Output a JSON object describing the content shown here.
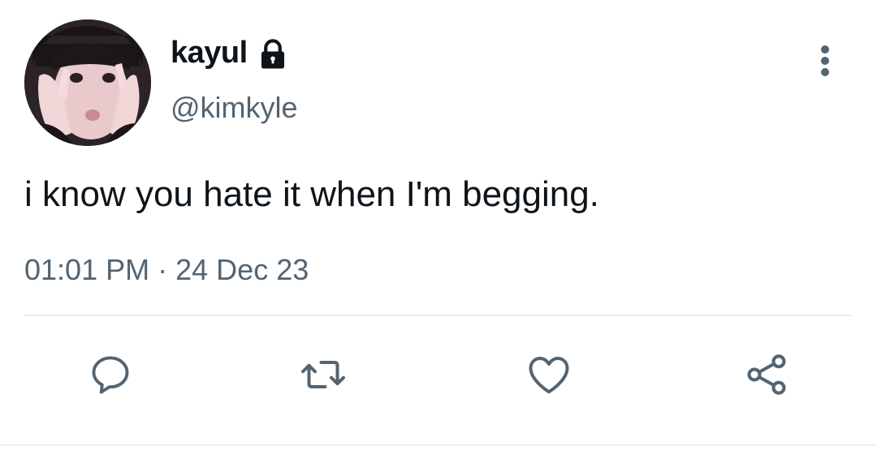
{
  "tweet": {
    "display_name": "kayul",
    "handle": "@kimkyle",
    "protected": true,
    "text": "i know you hate it when I'm begging.",
    "time": "01:01 PM",
    "separator": "·",
    "date": "24 Dec 23"
  },
  "icons": {
    "lock": "lock-icon",
    "more": "more-vertical-icon",
    "reply": "reply-icon",
    "retweet": "retweet-icon",
    "like": "heart-icon",
    "share": "share-icon"
  },
  "colors": {
    "text_primary": "#0f1419",
    "text_secondary": "#536471",
    "icon": "#536471",
    "divider": "#e6ecf0"
  }
}
